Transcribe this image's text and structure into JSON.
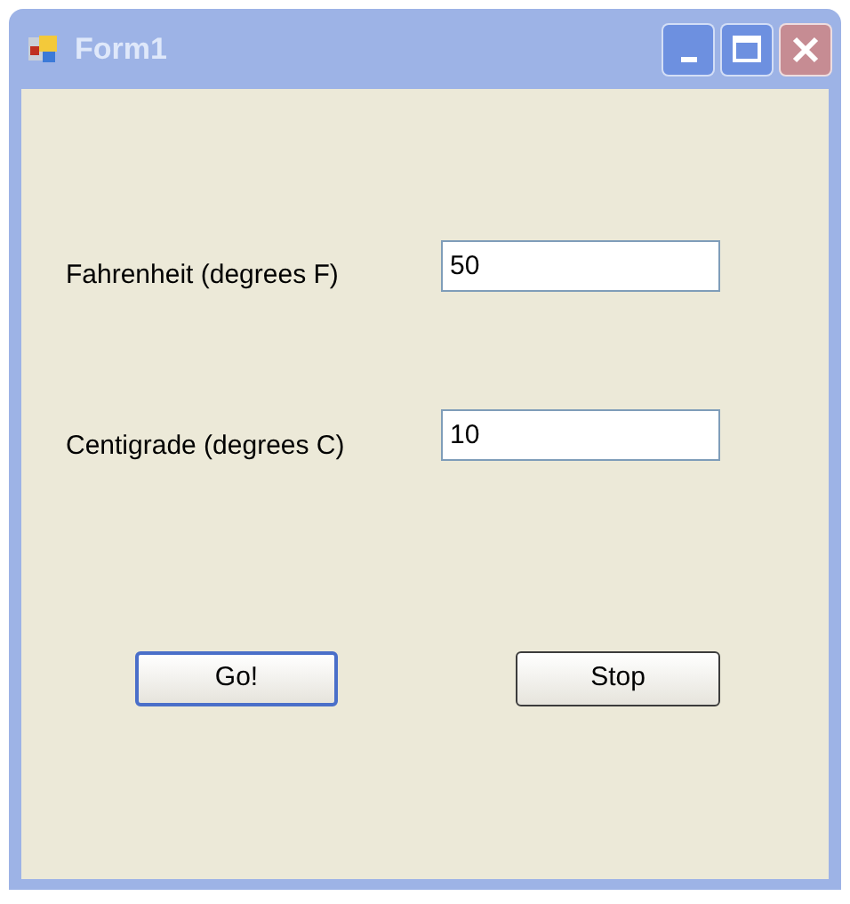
{
  "window": {
    "title": "Form1"
  },
  "fields": [
    {
      "label": "Fahrenheit (degrees F)",
      "value": "50"
    },
    {
      "label": "Centigrade (degrees C)",
      "value": "10"
    }
  ],
  "buttons": [
    {
      "label": "Go!",
      "default": true
    },
    {
      "label": "Stop",
      "default": false
    }
  ]
}
